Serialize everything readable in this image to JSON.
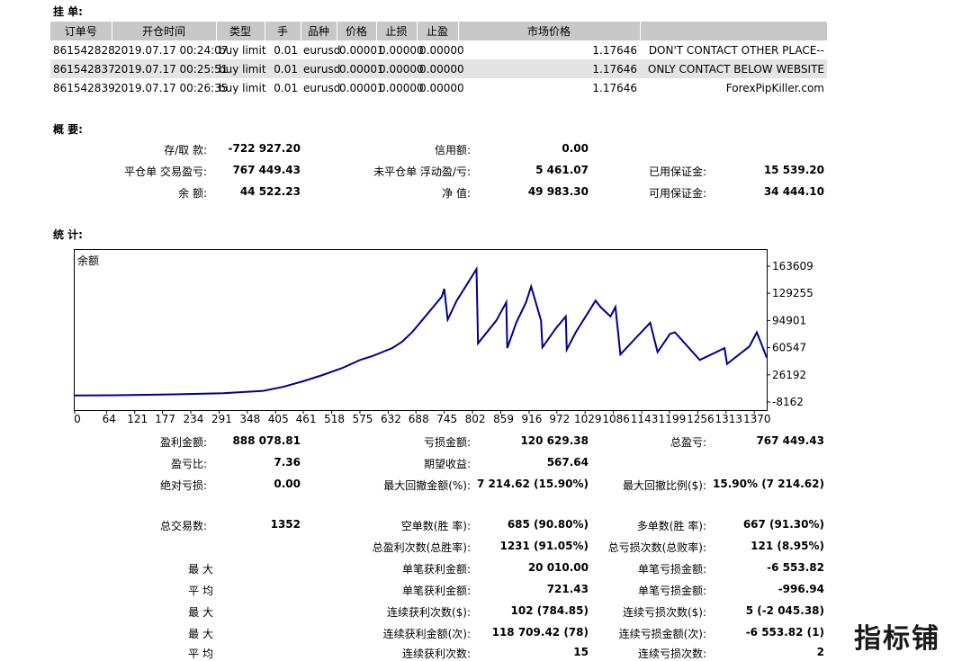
{
  "orders_title": "挂 单:",
  "orders": {
    "headers": [
      "订单号",
      "开仓时间",
      "类型",
      "手",
      "品种",
      "价格",
      "止损",
      "止盈",
      "市场价格",
      ""
    ],
    "rows": [
      [
        "861542828",
        "2019.07.17 00:24:07",
        "buy limit",
        "0.01",
        "eurusd",
        "0.00001",
        "0.00000",
        "0.00000",
        "1.17646",
        "DON'T CONTACT OTHER PLACE--"
      ],
      [
        "861542837",
        "2019.07.17 00:25:51",
        "buy limit",
        "0.01",
        "eurusd",
        "0.00001",
        "0.00000",
        "0.00000",
        "1.17646",
        "ONLY CONTACT BELOW WEBSITE"
      ],
      [
        "861542839",
        "2019.07.17 00:26:35",
        "buy limit",
        "0.01",
        "eurusd",
        "0.00001",
        "0.00000",
        "0.00000",
        "1.17646",
        "ForexPipKiller.com"
      ]
    ]
  },
  "summary_title": "概 要:",
  "summary": {
    "deposit_label": "存/取 款:",
    "deposit": "-722 927.20",
    "credit_label": "信用额:",
    "credit": "0.00",
    "closed_pl_label": "平仓单 交易盈亏:",
    "closed_pl": "767 449.43",
    "floating_pl_label": "未平仓单 浮动盈/亏:",
    "floating_pl": "5 461.07",
    "margin_label": "已用保证金:",
    "margin": "15 539.20",
    "balance_label": "余 额:",
    "balance": "44 522.23",
    "equity_label": "净 值:",
    "equity": "49 983.30",
    "free_margin_label": "可用保证金:",
    "free_margin": "34 444.10"
  },
  "stats_title": "统 计:",
  "chart_data": {
    "type": "line",
    "title": "余额",
    "y_ticks": [
      "163609",
      "129255",
      "94901",
      "60547",
      "26192",
      "-8162"
    ],
    "x_ticks": [
      "0",
      "64",
      "121",
      "177",
      "234",
      "291",
      "348",
      "405",
      "461",
      "518",
      "575",
      "632",
      "688",
      "745",
      "802",
      "859",
      "916",
      "972",
      "1029",
      "1086",
      "1143",
      "1199",
      "1256",
      "1313",
      "1370"
    ],
    "ylim": [
      -8162,
      163609
    ],
    "xlim": [
      0,
      1395
    ],
    "color": "#00008b",
    "series": [
      {
        "x": [
          0,
          100,
          200,
          300,
          380,
          420,
          460,
          500,
          540,
          575,
          600,
          620,
          640,
          660,
          680,
          700,
          720,
          740,
          745,
          752,
          770,
          790,
          810,
          813,
          850,
          870,
          872,
          890,
          910,
          920,
          940,
          943,
          970,
          990,
          992,
          1010,
          1050,
          1060,
          1080,
          1090,
          1100,
          1130,
          1160,
          1175,
          1200,
          1210,
          1260,
          1310,
          1315,
          1360,
          1375,
          1395
        ],
        "y": [
          0,
          500,
          1500,
          3000,
          6000,
          11000,
          18000,
          26000,
          35000,
          45000,
          50000,
          55000,
          60000,
          68000,
          80000,
          95000,
          110000,
          125000,
          135000,
          96000,
          120000,
          140000,
          160000,
          66000,
          95000,
          118000,
          60000,
          92000,
          118000,
          138000,
          95000,
          61000,
          85000,
          100000,
          58000,
          80000,
          120000,
          112000,
          100000,
          112000,
          52000,
          72000,
          92000,
          55000,
          78000,
          80000,
          45000,
          60000,
          40000,
          62000,
          80000,
          48000
        ]
      }
    ]
  },
  "stats": {
    "gross_profit_label": "盈利金额:",
    "gross_profit": "888 078.81",
    "gross_loss_label": "亏损金额:",
    "gross_loss": "120 629.38",
    "total_pl_label": "总盈亏:",
    "total_pl": "767 449.43",
    "profit_factor_label": "盈亏比:",
    "profit_factor": "7.36",
    "expected_payoff_label": "期望收益:",
    "expected_payoff": "567.64",
    "abs_drawdown_label": "绝对亏损:",
    "abs_drawdown": "0.00",
    "max_drawdown_label": "最大回撤金额(%):",
    "max_drawdown": "7 214.62 (15.90%)",
    "rel_drawdown_label": "最大回撤比例($):",
    "rel_drawdown": "15.90% (7 214.62)",
    "total_trades_label": "总交易数:",
    "total_trades": "1352",
    "short_label": "空单数(胜 率):",
    "short": "685 (90.80%)",
    "long_label": "多单数(胜 率):",
    "long": "667 (91.30%)",
    "profit_trades_label": "总盈利次数(总胜率):",
    "profit_trades": "1231 (91.05%)",
    "loss_trades_label": "总亏损次数(总败率):",
    "loss_trades": "121 (8.95%)",
    "largest_label": "最 大",
    "largest_profit_label": "单笔获利金额:",
    "largest_profit": "20 010.00",
    "largest_loss_label": "单笔亏损金额:",
    "largest_loss": "-6 553.82",
    "average_label": "平 均",
    "avg_profit_label": "单笔获利金额:",
    "avg_profit": "721.43",
    "avg_loss_label": "单笔亏损金额:",
    "avg_loss": "-996.94",
    "max1_label": "最 大",
    "max_consec_wins_label": "连续获利次数($):",
    "max_consec_wins": "102 (784.85)",
    "max_consec_losses_label": "连续亏损次数($):",
    "max_consec_losses": "5 (-2 045.38)",
    "max2_label": "最 大",
    "max_consec_profit_label": "连续获利金额(次):",
    "max_consec_profit": "118 709.42 (78)",
    "max_consec_loss_label": "连续亏损金额(次):",
    "max_consec_loss": "-6 553.82 (1)",
    "avg2_label": "平 均",
    "avg_consec_wins_label": "连续获利次数:",
    "avg_consec_wins": "15",
    "avg_consec_losses_label": "连续亏损次数:",
    "avg_consec_losses": "2"
  },
  "watermark": "指标铺"
}
